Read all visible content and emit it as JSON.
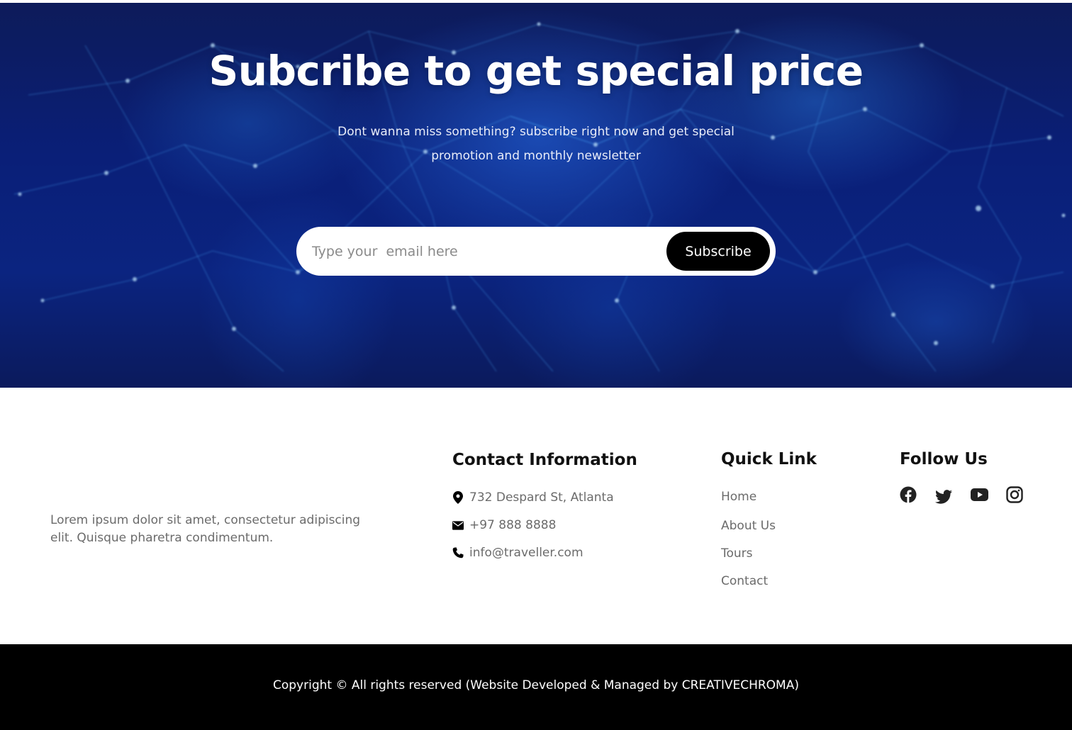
{
  "hero": {
    "title": "Subcribe to get special price",
    "subtitle": "Dont wanna miss something? subscribe right now and get special promotion and monthly newsletter",
    "email_placeholder": "Type your  email here",
    "subscribe_label": "Subscribe"
  },
  "about": {
    "text": "Lorem ipsum dolor sit amet, consectetur adipiscing elit. Quisque pharetra condimentum."
  },
  "contact": {
    "heading": "Contact Information",
    "items": [
      {
        "icon": "location-pin-icon",
        "text": "732 Despard St, Atlanta"
      },
      {
        "icon": "envelope-icon",
        "text": "+97 888 8888"
      },
      {
        "icon": "phone-icon",
        "text": "info@traveller.com"
      }
    ]
  },
  "quick_links": {
    "heading": "Quick Link",
    "items": [
      "Home",
      "About Us",
      "Tours",
      "Contact"
    ]
  },
  "follow": {
    "heading": "Follow Us",
    "icons": [
      "facebook-icon",
      "twitter-icon",
      "youtube-icon",
      "instagram-icon"
    ]
  },
  "footer": {
    "copyright": "Copyright © All rights reserved (Website Developed & Managed by CREATIVECHROMA)"
  },
  "colors": {
    "hero_bg": "#0a1f78",
    "accent_glow": "#3fb6ff",
    "button_bg": "#000000",
    "bottom_bar": "#000000",
    "muted_text": "#6b6b6b"
  }
}
